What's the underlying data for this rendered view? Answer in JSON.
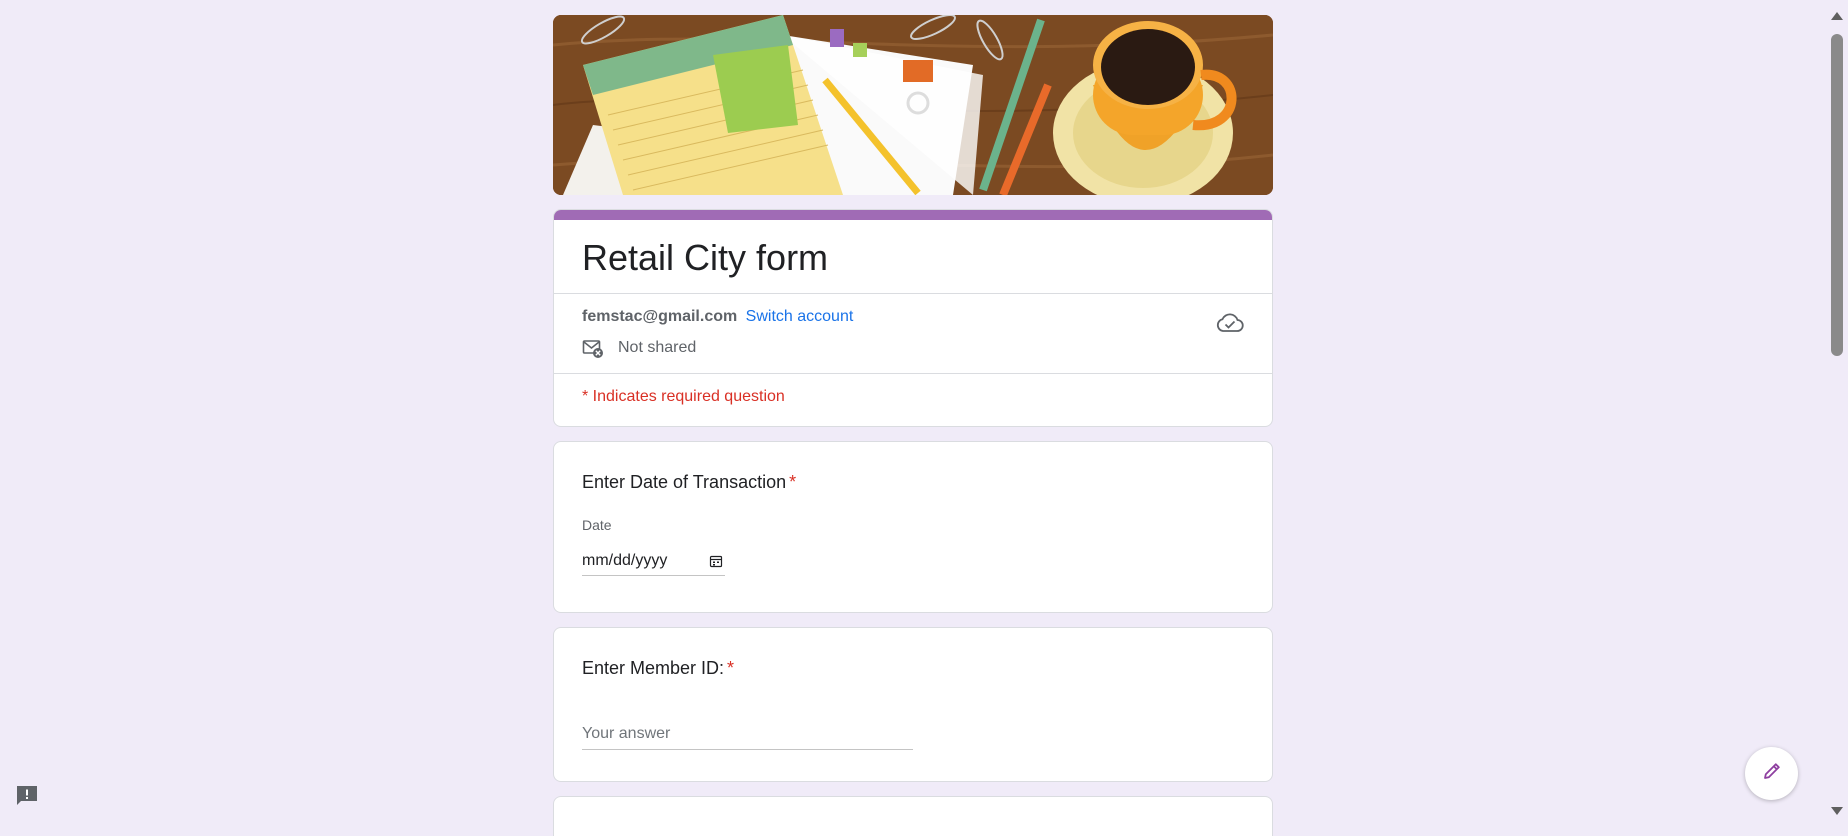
{
  "form": {
    "title": "Retail City form",
    "account_email": "femstac@gmail.com",
    "switch_account": "Switch account",
    "sharing_status": "Not shared",
    "required_note": "* Indicates required question"
  },
  "questions": [
    {
      "title": "Enter Date of Transaction",
      "required_mark": "*",
      "sublabel": "Date",
      "placeholder": "mm/dd/yyyy"
    },
    {
      "title": "Enter Member ID:",
      "required_mark": "*",
      "placeholder": "Your answer"
    }
  ],
  "colors": {
    "background": "#f0ebf8",
    "accent": "#a06bb5",
    "link": "#1a73e8",
    "required": "#d93025"
  },
  "icons": {
    "cloud": "cloud-check-icon",
    "sharing": "mail-not-shared-icon",
    "calendar": "calendar-icon",
    "feedback": "report-feedback-icon",
    "edit": "pencil-edit-icon"
  }
}
